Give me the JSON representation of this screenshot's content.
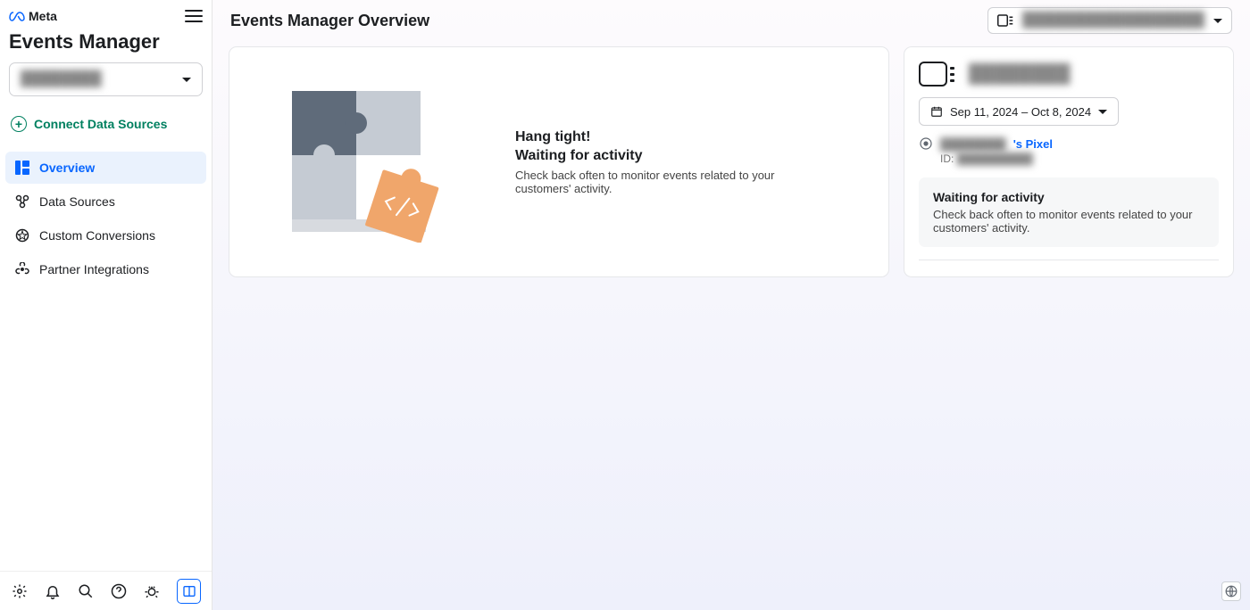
{
  "brand": {
    "name": "Meta"
  },
  "product_title": "Events Manager",
  "account_selector": {
    "label_masked": "████████"
  },
  "connect": {
    "label": "Connect Data Sources"
  },
  "nav": [
    {
      "id": "overview",
      "label": "Overview",
      "active": true
    },
    {
      "id": "data-sources",
      "label": "Data Sources",
      "active": false
    },
    {
      "id": "custom-conversions",
      "label": "Custom Conversions",
      "active": false
    },
    {
      "id": "partner-integrations",
      "label": "Partner Integrations",
      "active": false
    }
  ],
  "page_title": "Events Manager Overview",
  "dataset_picker": {
    "label_masked": "██████████████████"
  },
  "main_card": {
    "heading_line1": "Hang tight!",
    "heading_line2": "Waiting for activity",
    "body": "Check back often to monitor events related to your customers' activity."
  },
  "side_panel": {
    "title_masked": "████████",
    "date_range": "Sep 11, 2024 – Oct 8, 2024",
    "pixel_name_prefix_masked": "████████",
    "pixel_name_suffix": "'s Pixel",
    "pixel_id_label": "ID:",
    "pixel_id_masked": "██████████",
    "info": {
      "title": "Waiting for activity",
      "body": "Check back often to monitor events related to your customers' activity."
    }
  }
}
